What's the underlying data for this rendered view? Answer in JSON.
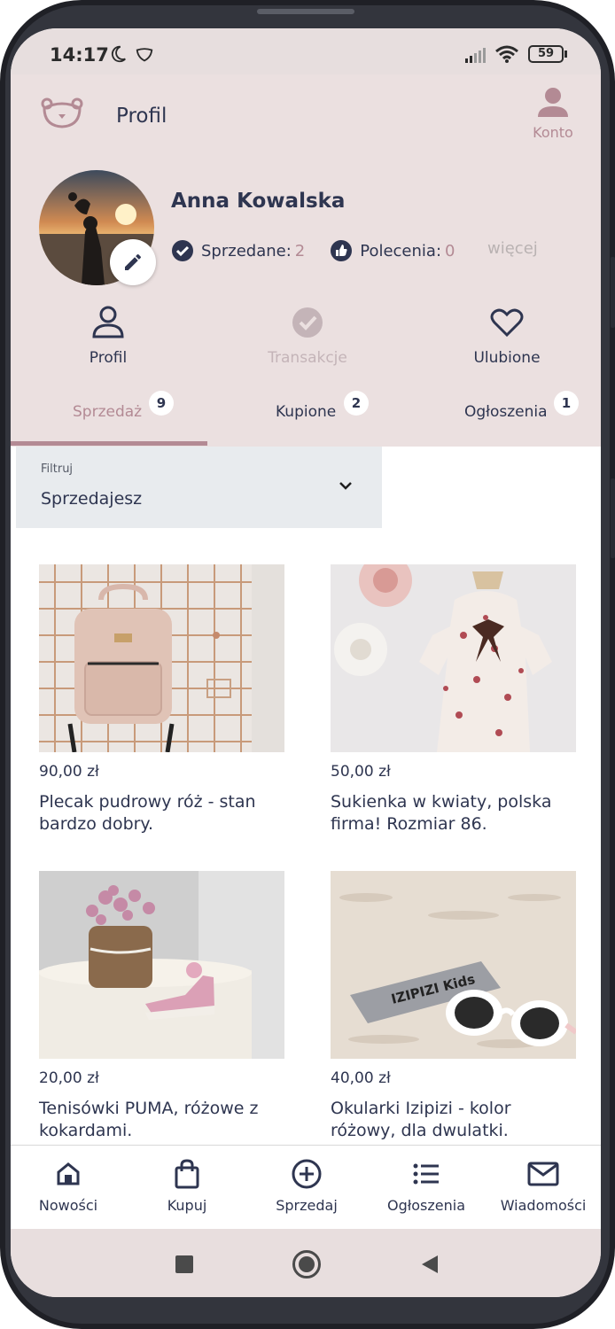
{
  "status_bar": {
    "time": "14:17",
    "battery": "59"
  },
  "header": {
    "title": "Profil",
    "account_label": "Konto"
  },
  "profile": {
    "name": "Anna Kowalska",
    "sold_label": "Sprzedane:",
    "sold_count": "2",
    "recommendations_label": "Polecenia:",
    "recommendations_count": "0",
    "more_label": "więcej"
  },
  "profile_nav": [
    {
      "label": "Profil",
      "icon": "person-icon",
      "color": "#2e3550"
    },
    {
      "label": "Transakcje",
      "icon": "check-circle-icon",
      "color": "#c4b4b8"
    },
    {
      "label": "Ulubione",
      "icon": "heart-icon",
      "color": "#2e3550"
    }
  ],
  "tabs": [
    {
      "label": "Sprzedaż",
      "badge": "9",
      "active": true
    },
    {
      "label": "Kupione",
      "badge": "2",
      "active": false
    },
    {
      "label": "Ogłoszenia",
      "badge": "1",
      "active": false
    }
  ],
  "filter": {
    "label": "Filtruj",
    "value": "Sprzedajesz"
  },
  "products": [
    {
      "price": "90,00 zł",
      "title": "Plecak pudrowy róż - stan bardzo dobry."
    },
    {
      "price": "50,00 zł",
      "title": "Sukienka w kwiaty, polska firma! Rozmiar 86."
    },
    {
      "price": "20,00 zł",
      "title": "Tenisówki PUMA, różowe z kokardami."
    },
    {
      "price": "40,00 zł",
      "title": "Okularki Izipizi - kolor różowy, dla dwulatki."
    }
  ],
  "product_image_text": {
    "glasses_case_brand": "IZIPIZI Kids"
  },
  "bottom_nav": [
    {
      "label": "Nowości",
      "icon": "home-icon"
    },
    {
      "label": "Kupuj",
      "icon": "shopping-bag-icon"
    },
    {
      "label": "Sprzedaj",
      "icon": "plus-circle-icon"
    },
    {
      "label": "Ogłoszenia",
      "icon": "list-icon"
    },
    {
      "label": "Wiadomości",
      "icon": "mail-icon"
    }
  ],
  "colors": {
    "accent": "#b38a94",
    "navy": "#2e3550",
    "header_bg": "#ebe0e0"
  }
}
